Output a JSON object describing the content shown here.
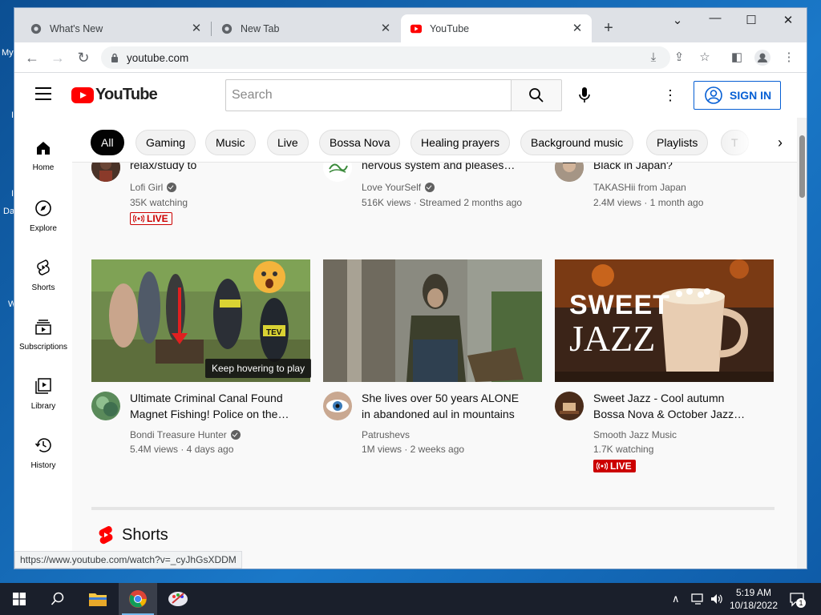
{
  "desktop": {
    "edge_labels": [
      "My",
      "I",
      "I",
      "Da",
      "W"
    ]
  },
  "browser": {
    "tabs": [
      {
        "title": "What's New",
        "active": false
      },
      {
        "title": "New Tab",
        "active": false
      },
      {
        "title": "YouTube",
        "active": true
      }
    ],
    "address": "youtube.com",
    "status_url": "https://www.youtube.com/watch?v=_cyJhGsXDDM"
  },
  "youtube": {
    "logo_text": "YouTube",
    "search_placeholder": "Search",
    "sign_in_label": "SIGN IN",
    "guide": [
      {
        "label": "Home",
        "icon": "home-icon"
      },
      {
        "label": "Explore",
        "icon": "compass-icon"
      },
      {
        "label": "Shorts",
        "icon": "shorts-icon"
      },
      {
        "label": "Subscriptions",
        "icon": "subscriptions-icon"
      },
      {
        "label": "Library",
        "icon": "library-icon"
      },
      {
        "label": "History",
        "icon": "history-icon"
      }
    ],
    "chips": [
      "All",
      "Gaming",
      "Music",
      "Live",
      "Bossa Nova",
      "Healing prayers",
      "Background music",
      "Playlists",
      "T"
    ],
    "row1": [
      {
        "title": "relax/study to",
        "channel": "Lofi Girl",
        "verified": true,
        "meta": "35K watching",
        "live": true
      },
      {
        "title": "nervous system and pleases…",
        "channel": "Love YourSelf",
        "verified": true,
        "meta": "516K views · Streamed 2 months ago",
        "live": false
      },
      {
        "title": "Black in Japan?",
        "channel": "TAKASHii from Japan",
        "verified": false,
        "meta": "2.4M views · 1 month ago",
        "live": false
      }
    ],
    "row2": [
      {
        "title_line1": "Ultimate Criminal Canal Found",
        "title_line2": "Magnet Fishing! Police on the…",
        "channel": "Bondi Treasure Hunter",
        "verified": true,
        "meta": "5.4M views · 4 days ago",
        "live": false
      },
      {
        "title_line1": "She lives over 50 years ALONE",
        "title_line2": "in abandoned aul in mountains",
        "channel": "Patrushevs",
        "verified": false,
        "meta": "1M views · 2 weeks ago",
        "live": false
      },
      {
        "title_line1": "Sweet Jazz - Cool autumn",
        "title_line2": "Bossa Nova & October Jazz…",
        "channel": "Smooth Jazz Music",
        "verified": false,
        "meta": "1.7K watching",
        "live": true
      }
    ],
    "thumb_text": {
      "sweet": "SWEET",
      "jazz": "JAZZ",
      "tev": "TEV"
    },
    "live_label": "LIVE",
    "tooltip": "Keep hovering to play",
    "shorts_heading": "Shorts"
  },
  "taskbar": {
    "time": "5:19 AM",
    "date": "10/18/2022",
    "notification_count": "1"
  }
}
